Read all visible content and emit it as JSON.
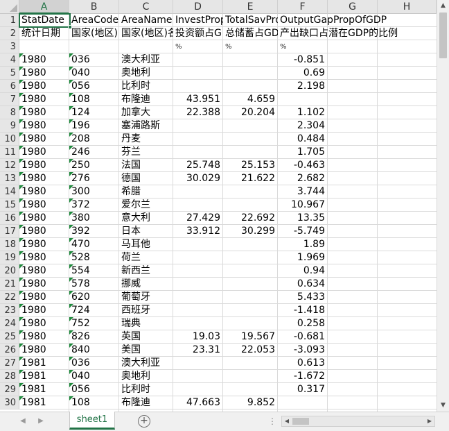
{
  "columns": [
    "A",
    "B",
    "C",
    "D",
    "E",
    "F",
    "G",
    "H"
  ],
  "row_numbers": [
    "1",
    "2",
    "3",
    "4",
    "5",
    "6",
    "7",
    "8",
    "9",
    "10",
    "11",
    "12",
    "13",
    "14",
    "15",
    "16",
    "17",
    "18",
    "19",
    "20",
    "21",
    "22",
    "23",
    "24",
    "25",
    "26",
    "27",
    "28",
    "29",
    "30"
  ],
  "header_row": [
    "StatDate",
    "AreaCode",
    "AreaName",
    "InvestProp",
    "TotalSavPro",
    "OutputGapPropOfGDP"
  ],
  "desc_row": [
    "统计日期",
    "国家(地区)",
    "国家(地区)名",
    "投资额占G",
    "总储蓄占GD",
    "产出缺口占潜在GDP的比例"
  ],
  "unit_row": [
    "",
    "",
    "",
    "%",
    "%",
    "%"
  ],
  "data_rows": [
    [
      "1980",
      "036",
      "澳大利亚",
      "",
      "",
      "-0.851"
    ],
    [
      "1980",
      "040",
      "奥地利",
      "",
      "",
      "0.69"
    ],
    [
      "1980",
      "056",
      "比利时",
      "",
      "",
      "2.198"
    ],
    [
      "1980",
      "108",
      "布隆迪",
      "43.951",
      "4.659",
      ""
    ],
    [
      "1980",
      "124",
      "加拿大",
      "22.388",
      "20.204",
      "1.102"
    ],
    [
      "1980",
      "196",
      "塞浦路斯",
      "",
      "",
      "2.304"
    ],
    [
      "1980",
      "208",
      "丹麦",
      "",
      "",
      "0.484"
    ],
    [
      "1980",
      "246",
      "芬兰",
      "",
      "",
      "1.705"
    ],
    [
      "1980",
      "250",
      "法国",
      "25.748",
      "25.153",
      "-0.463"
    ],
    [
      "1980",
      "276",
      "德国",
      "30.029",
      "21.622",
      "2.682"
    ],
    [
      "1980",
      "300",
      "希腊",
      "",
      "",
      "3.744"
    ],
    [
      "1980",
      "372",
      "爱尔兰",
      "",
      "",
      "10.967"
    ],
    [
      "1980",
      "380",
      "意大利",
      "27.429",
      "22.692",
      "13.35"
    ],
    [
      "1980",
      "392",
      "日本",
      "33.912",
      "30.299",
      "-5.749"
    ],
    [
      "1980",
      "470",
      "马耳他",
      "",
      "",
      "1.89"
    ],
    [
      "1980",
      "528",
      "荷兰",
      "",
      "",
      "1.969"
    ],
    [
      "1980",
      "554",
      "新西兰",
      "",
      "",
      "0.94"
    ],
    [
      "1980",
      "578",
      "挪威",
      "",
      "",
      "0.634"
    ],
    [
      "1980",
      "620",
      "葡萄牙",
      "",
      "",
      "5.433"
    ],
    [
      "1980",
      "724",
      "西班牙",
      "",
      "",
      "-1.418"
    ],
    [
      "1980",
      "752",
      "瑞典",
      "",
      "",
      "0.258"
    ],
    [
      "1980",
      "826",
      "英国",
      "19.03",
      "19.567",
      "-0.681"
    ],
    [
      "1980",
      "840",
      "美国",
      "23.31",
      "22.053",
      "-3.093"
    ],
    [
      "1981",
      "036",
      "澳大利亚",
      "",
      "",
      "0.613"
    ],
    [
      "1981",
      "040",
      "奥地利",
      "",
      "",
      "-1.672"
    ],
    [
      "1981",
      "056",
      "比利时",
      "",
      "",
      "0.317"
    ],
    [
      "1981",
      "108",
      "布隆迪",
      "47.663",
      "9.852",
      ""
    ]
  ],
  "sheet_tab": "sheet1",
  "add_sheet": "+",
  "icons": {
    "scroll_up": "▲",
    "scroll_down": "▼",
    "scroll_left": "◀",
    "scroll_right": "▶",
    "nav_prev": "◀",
    "nav_next": "▶",
    "split_dots": "⋮"
  }
}
